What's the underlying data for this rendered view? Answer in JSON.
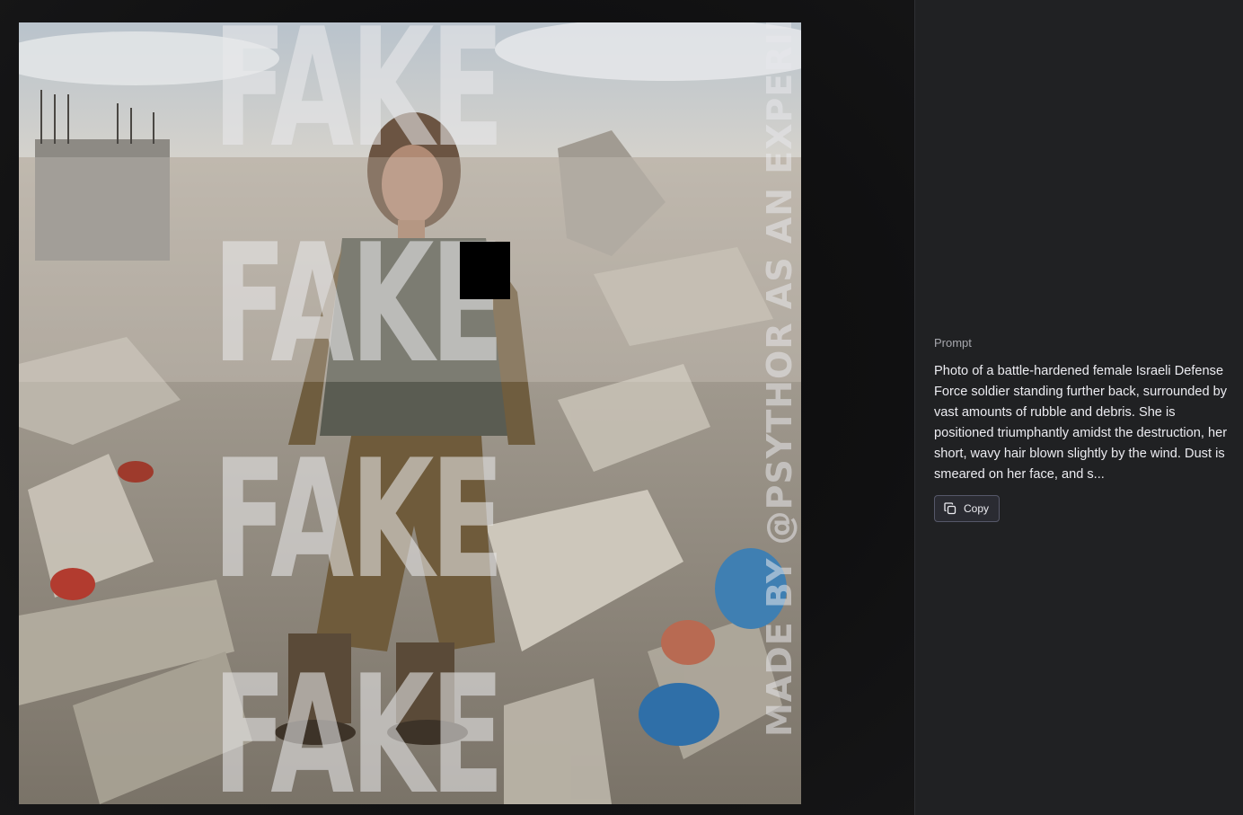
{
  "image": {
    "watermark_words": [
      "FAKE",
      "FAKE",
      "FAKE",
      "FAKE"
    ],
    "vertical_credit": "MADE BY @PSYTHOR AS AN EXPERIMENT"
  },
  "sidebar": {
    "prompt_label": "Prompt",
    "prompt_text": "Photo of a battle-hardened female Israeli Defense Force soldier standing further back, surrounded by vast amounts of rubble and debris. She is positioned triumphantly amidst the destruction, her short, wavy hair blown slightly by the wind. Dust is smeared on her face, and s...",
    "copy_button_label": "Copy"
  },
  "colors": {
    "sidebar_bg": "#202123",
    "viewer_bg": "#101011",
    "button_border": "#565869"
  },
  "icons": {
    "copy_button": "copy-icon"
  }
}
